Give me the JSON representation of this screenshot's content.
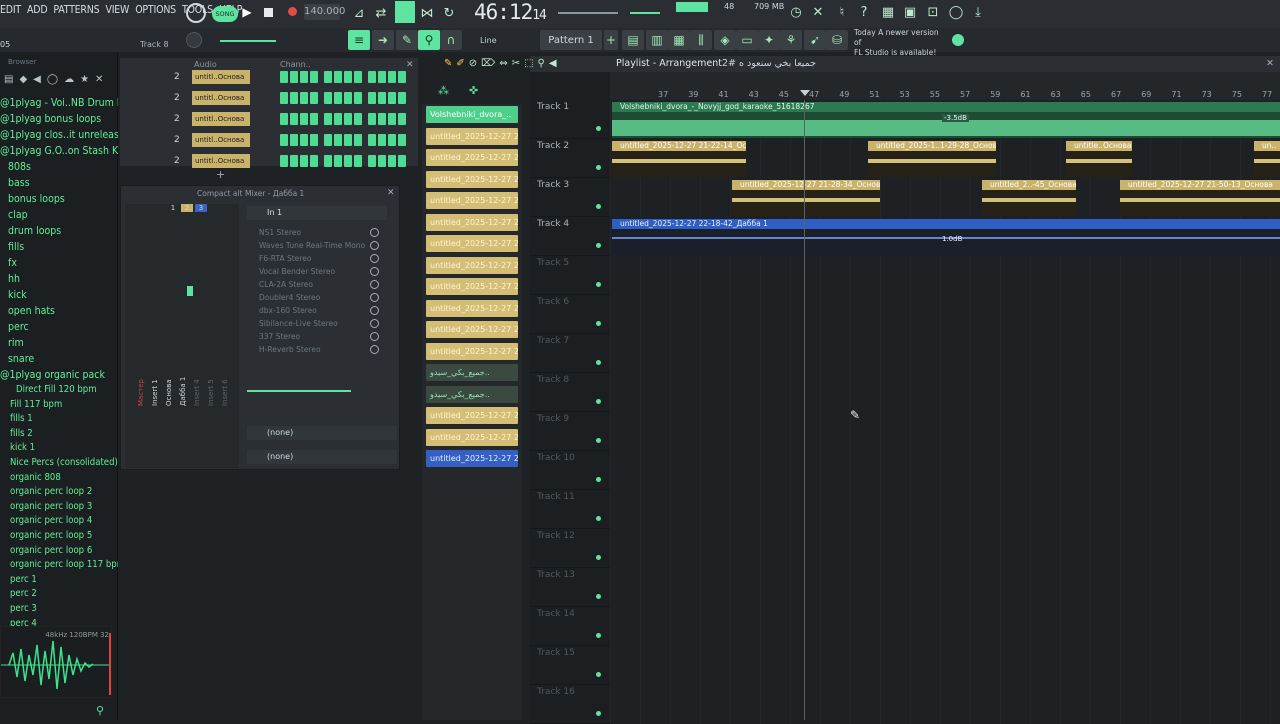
{
  "menu": [
    "EDIT",
    "ADD",
    "PATTERNS",
    "VIEW",
    "OPTIONS",
    "TOOLS",
    "HELP"
  ],
  "transport": {
    "tempo": "140.000",
    "time": "46:12",
    "time_sub": "14",
    "cpu": "48",
    "ram": "709 MB",
    "pattern_mode": "SONG"
  },
  "toolbar": {
    "track_label": "Track 8",
    "snap": "Line",
    "pattern": "Pattern 1",
    "left_num": "05"
  },
  "news": {
    "line1": "Today  A newer version of",
    "line2": "FL Studio is available!"
  },
  "browser": {
    "title": "Browser",
    "items": [
      "@1plyag - Voi..NB Drum Kit)",
      "@1plyag bonus loops",
      "@1plyag clos..it unreleased",
      "@1plyag G.O..on Stash Kit",
      "808s",
      "bass",
      "bonus loops",
      "clap",
      "drum loops",
      "fills",
      "fx",
      "hh",
      "kick",
      "open hats",
      "perc",
      "rim",
      "snare",
      "@1plyag organic pack"
    ],
    "files": [
      "Direct Fill 120 bpm",
      "Fill 117 bpm",
      "fills 1",
      "fills 2",
      "kick 1",
      "Nice Percs (consolidated)",
      "organic 808",
      "organic perc loop 2",
      "organic perc loop 3",
      "organic perc loop 4",
      "organic perc loop 5",
      "organic perc loop 6",
      "organic perc loop 117 bpm",
      "perc 1",
      "perc 2",
      "perc 3",
      "perc 4"
    ],
    "preview_info": "48kHz 120BPM 32"
  },
  "channel_rack": {
    "tab_audio": "Audio",
    "tab_chan": "Chann..",
    "rows": [
      {
        "num": "2",
        "name": "untitl..Основа"
      },
      {
        "num": "2",
        "name": "untitl..Основа"
      },
      {
        "num": "2",
        "name": "untitl..Основа"
      },
      {
        "num": "2",
        "name": "untitl..Основа"
      },
      {
        "num": "2",
        "name": "untitl..Основа"
      }
    ]
  },
  "mixer": {
    "title": "Compact alt  Mixer - Дабба 1",
    "input": "In 1",
    "fx": [
      "NS1 Stereo",
      "Waves Tune Real-Time Mono",
      "F6-RTA Stereo",
      "Vocal Bender Stereo",
      "CLA-2A Stereo",
      "Doubler4 Stereo",
      "dbx-160 Stereo",
      "Sibilance-Live Stereo",
      "337 Stereo",
      "H-Reverb Stereo"
    ],
    "send1": "(none)",
    "send2": "(none)",
    "strips": [
      "Мастер",
      "Insert 1",
      "Основа",
      "Дабба 1",
      "Insert 4",
      "Insert 5",
      "Insert 6"
    ],
    "strip_nums": [
      "1",
      "2",
      "3"
    ]
  },
  "patterns": [
    "Volshebniki_dvora_..",
    "untitled_2025-12-27 21..",
    "untitled_2025-12-27 21..",
    "untitled_2025-12-27 21..",
    "untitled_2025-12-27 21..",
    "untitled_2025-12-27 21..",
    "untitled_2025-12-27 21..",
    "untitled_2025-12-27 21..",
    "untitled_2025-12-27 21..",
    "untitled_2025-12-27 21..",
    "untitled_2025-12-27 22..",
    "untitled_2025-12-27 22..",
    "جميع_بكي_سيدو..",
    "جميع_بكي_سيدو..",
    "untitled_2025-12-27 22..",
    "untitled_2025-12-27 22..",
    "untitled_2025-12-27 22.."
  ],
  "playlist": {
    "title": "Playlist - Arrangement",
    "arrangement": "جميعا بخي سنعود ه #2",
    "ruler": [
      "37",
      "39",
      "41",
      "43",
      "45",
      "47",
      "49",
      "51",
      "53",
      "55",
      "57",
      "59",
      "61",
      "63",
      "65",
      "67",
      "69",
      "71",
      "73",
      "75",
      "77"
    ],
    "tracks": [
      "Track 1",
      "Track 2",
      "Track 3",
      "Track 4",
      "Track 5",
      "Track 6",
      "Track 7",
      "Track 8",
      "Track 9",
      "Track 10",
      "Track 11",
      "Track 12",
      "Track 13",
      "Track 14",
      "Track 15",
      "Track 16"
    ],
    "clips": {
      "t1": "Volshebniki_dvora_-_Novyjj_god_karaoke_51618267",
      "t1_db": "-3.5dB",
      "t2a": "untitled_2025-12-27 21-22-14_Основа",
      "t2b": "untitled_2025-1..1-29-28_Основа",
      "t2c": "untitle..Основа",
      "t2d": "un..",
      "t3a": "untitled_2025-12-27 21-28-34_Основа",
      "t3b": "untitled_2..-45_Основа",
      "t3c": "untitled_2025-12-27 21-50-13_Основа",
      "t4": "untitled_2025-12-27 22-18-42_Дабба 1",
      "t4_db": "1.0dB"
    }
  },
  "colors": {
    "accent": "#5fe3a1",
    "clip_gold": "#d4bd74",
    "clip_blue": "#2f5fc4",
    "bg": "#1f2225"
  }
}
